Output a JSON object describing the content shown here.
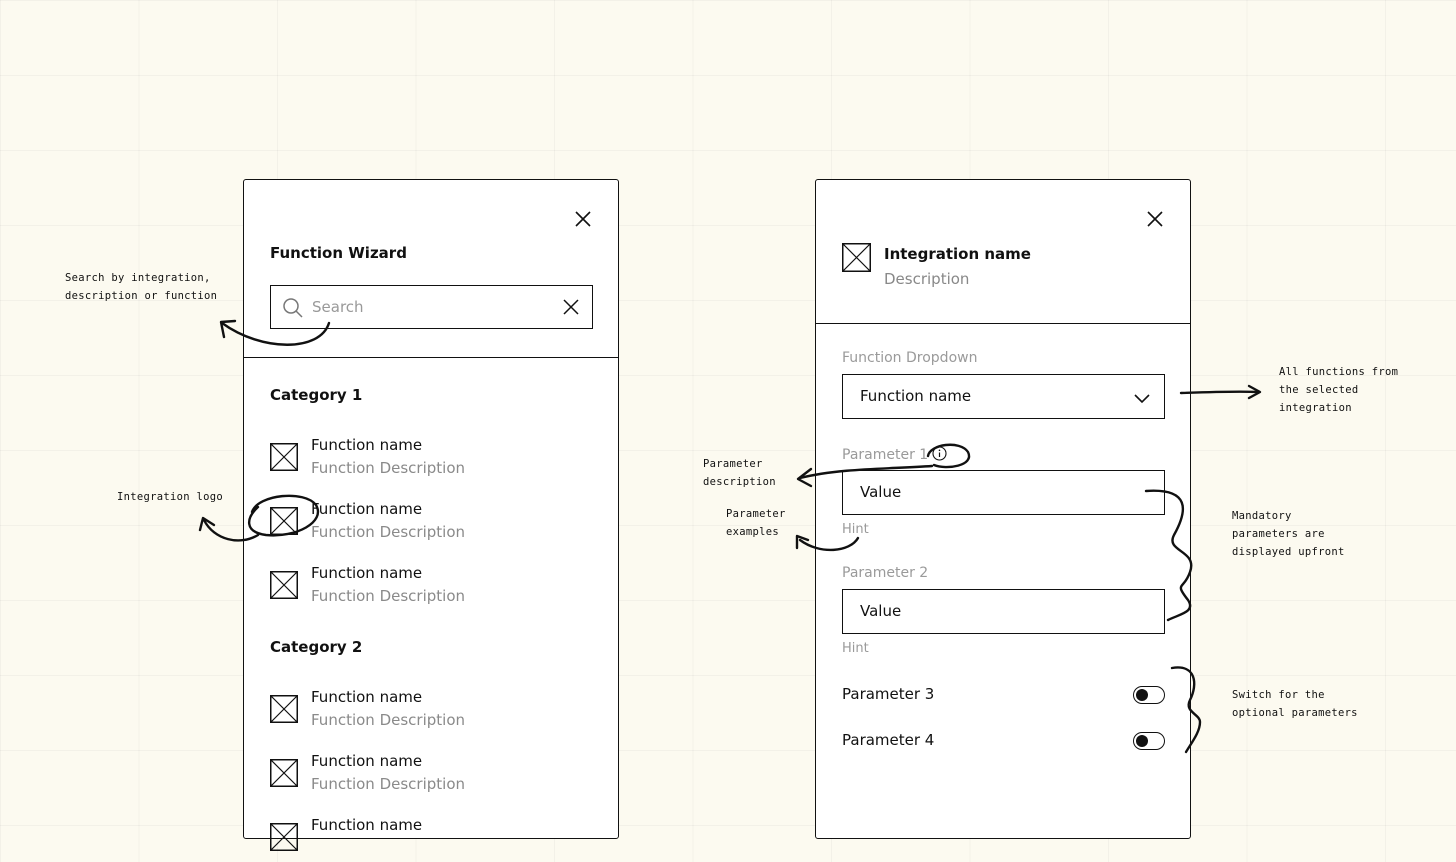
{
  "wizard": {
    "title": "Function Wizard",
    "search_placeholder": "Search",
    "categories": [
      {
        "label": "Category 1",
        "items": [
          {
            "name": "Function name",
            "description": "Function Description"
          },
          {
            "name": "Function name",
            "description": "Function Description"
          },
          {
            "name": "Function name",
            "description": "Function Description"
          }
        ]
      },
      {
        "label": "Category 2",
        "items": [
          {
            "name": "Function name",
            "description": "Function Description"
          },
          {
            "name": "Function name",
            "description": "Function Description"
          },
          {
            "name": "Function name",
            "description": ""
          }
        ]
      }
    ]
  },
  "integration": {
    "name": "Integration name",
    "description": "Description",
    "dropdown_label": "Function Dropdown",
    "dropdown_value": "Function name",
    "parameters": [
      {
        "label": "Parameter 1",
        "value": "Value",
        "hint": "Hint"
      },
      {
        "label": "Parameter 2",
        "value": "Value",
        "hint": "Hint"
      }
    ],
    "optional_parameters": [
      {
        "label": "Parameter 3",
        "on": false
      },
      {
        "label": "Parameter 4",
        "on": false
      }
    ]
  },
  "annotations": {
    "search": "Search by integration,\ndescription or function",
    "logo": "Integration logo",
    "param_description": "Parameter\ndescription",
    "param_examples": "Parameter\nexamples",
    "all_functions": "All functions from\nthe selected\nintegration",
    "mandatory": "Mandatory\nparameters are\ndisplayed upfront",
    "switch": "Switch for the\noptional parameters"
  }
}
